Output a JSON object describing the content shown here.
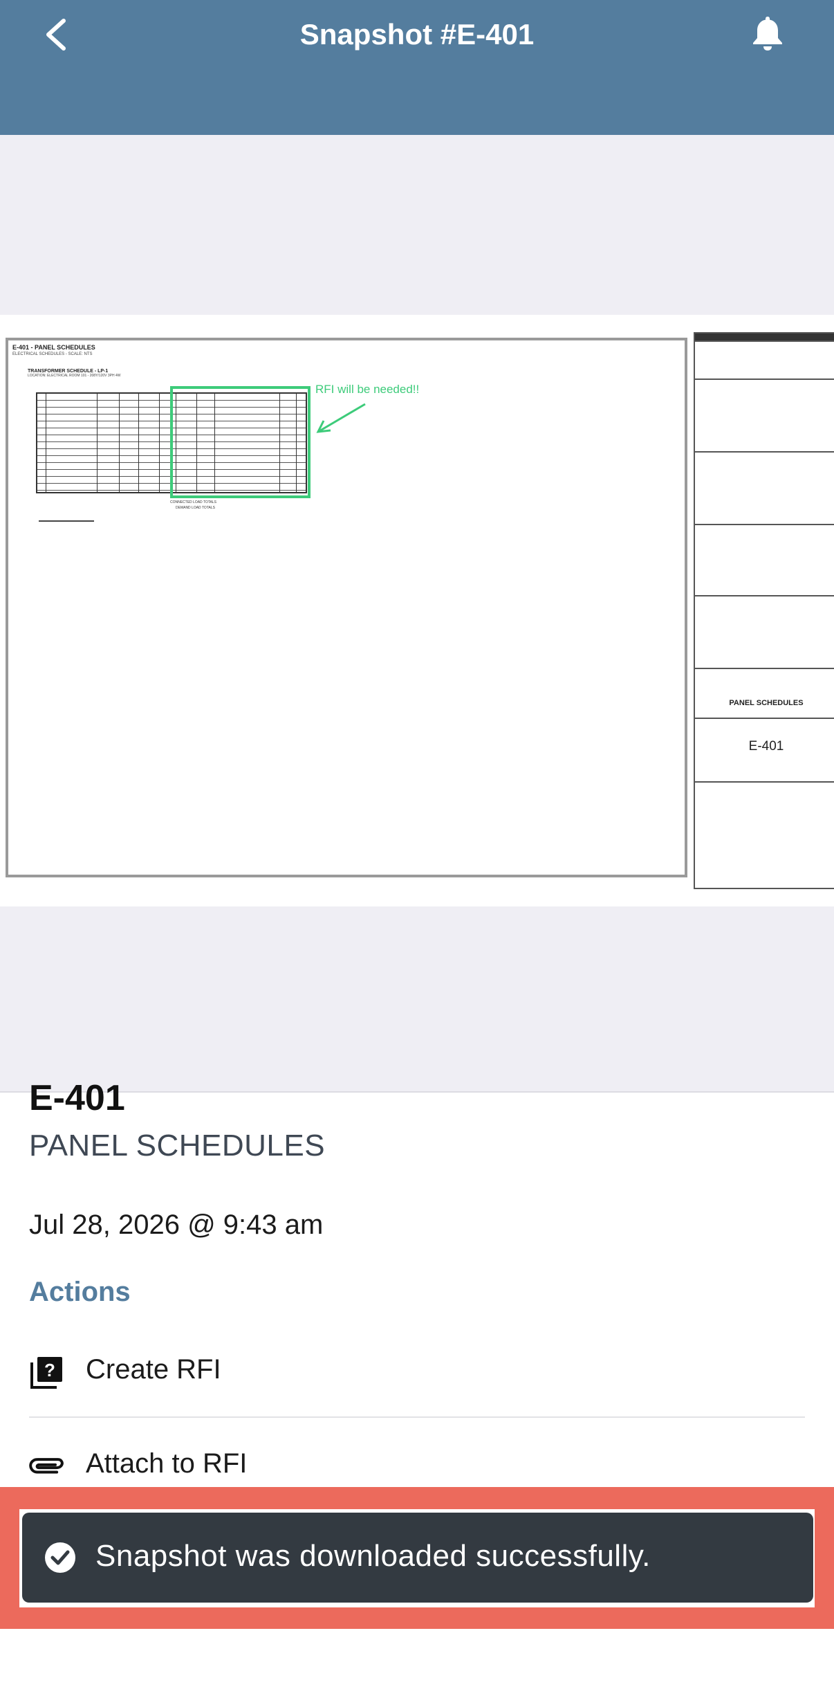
{
  "header": {
    "title": "Snapshot #E-401",
    "back_icon": "chevron-left-icon",
    "notifications_icon": "bell-icon",
    "background_color": "#547D9E"
  },
  "drawing": {
    "sheet_heading": "E-401 - PANEL SCHEDULES",
    "sheet_subheading": "ELECTRICAL SCHEDULES - SCALE: NTS",
    "table_title": "TRANSFORMER SCHEDULE - LP-1",
    "table_subtitle": "LOCATION: ELECTRICAL ROOM 101 - 208Y/120V 3PH 4W",
    "annotation_text": "RFI will be needed!!",
    "annotation_color": "#3DCB7A",
    "title_block_sheet_title": "PANEL SCHEDULES",
    "title_block_sheet_number": "E-401"
  },
  "details": {
    "sheet_number": "E-401",
    "sheet_title": "PANEL SCHEDULES",
    "timestamp": "Jul 28, 2026 @ 9:43 am",
    "actions_heading": "Actions",
    "actions": [
      {
        "label": "Create RFI",
        "icon": "rfi-question-icon"
      },
      {
        "label": "Attach to RFI",
        "icon": "paperclip-icon"
      }
    ]
  },
  "toast": {
    "message": "Snapshot was downloaded successfully.",
    "icon": "check-circle-icon",
    "highlight_color": "#EC6A5C"
  }
}
